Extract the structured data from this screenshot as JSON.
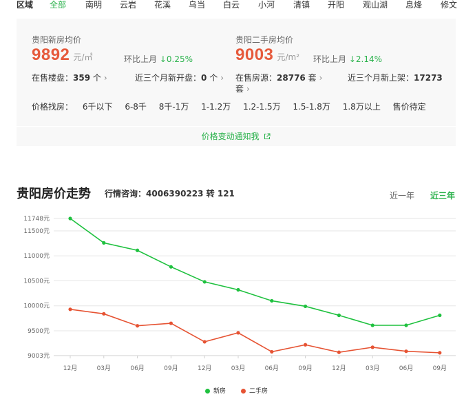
{
  "nav": {
    "label": "区域",
    "items": [
      "全部",
      "南明",
      "云岩",
      "花溪",
      "乌当",
      "白云",
      "小河",
      "清镇",
      "开阳",
      "观山湖",
      "息烽",
      "修文"
    ],
    "active_index": 0
  },
  "new_house": {
    "title": "贵阳新房均价",
    "price": "9892",
    "unit": "元/㎡",
    "change_label": "环比上月",
    "change_arrow": "↓",
    "change_value": "0.25%",
    "on_sale_label": "在售楼盘：",
    "on_sale_value": "359",
    "on_sale_suffix": "个",
    "recent_label": "近三个月新开盘：",
    "recent_value": "0",
    "recent_suffix": "个"
  },
  "second_house": {
    "title": "贵阳二手房均价",
    "price": "9003",
    "unit": "元/m²",
    "change_label": "环比上月",
    "change_arrow": "↓",
    "change_value": "2.14%",
    "on_sale_label": "在售房源：",
    "on_sale_value": "28776",
    "on_sale_suffix": "套",
    "recent_label": "近三个月新上架：",
    "recent_value": "17273",
    "recent_suffix": "套"
  },
  "filter": {
    "label": "价格找房：",
    "options": [
      "6千以下",
      "6-8千",
      "8千-1万",
      "1-1.2万",
      "1.2-1.5万",
      "1.5-1.8万",
      "1.8万以上",
      "售价待定"
    ]
  },
  "notify": {
    "text": "价格变动通知我",
    "icon": "external-link-icon"
  },
  "chart_section": {
    "title": "贵阳房价走势",
    "hotline": "行情咨询：4006390223 转 121",
    "range_tabs": [
      "近一年",
      "近三年"
    ],
    "active_range": 1
  },
  "colors": {
    "accent": "#2bb24c",
    "price": "#e65a3c",
    "new_series": "#1fc13f",
    "second_series": "#e65333"
  },
  "chart_data": {
    "type": "line",
    "categories": [
      "12月",
      "03月",
      "06月",
      "09月",
      "12月",
      "03月",
      "06月",
      "09月",
      "12月",
      "03月",
      "06月",
      "09月"
    ],
    "y_ticks": [
      9003,
      9500,
      10000,
      10500,
      11000,
      11500,
      11748
    ],
    "y_tick_labels": [
      "9003元",
      "9500元",
      "10000元",
      "10500元",
      "11000元",
      "11500元",
      "11748元"
    ],
    "ylim": [
      9003,
      11748
    ],
    "grid": true,
    "legend_position": "bottom",
    "series": [
      {
        "name": "新房",
        "values": [
          11748,
          11260,
          11110,
          10780,
          10480,
          10320,
          10100,
          9990,
          9810,
          9610,
          9610,
          9810
        ]
      },
      {
        "name": "二手房",
        "values": [
          9930,
          9840,
          9600,
          9650,
          9280,
          9460,
          9080,
          9220,
          9070,
          9170,
          9090,
          9060
        ]
      }
    ]
  }
}
